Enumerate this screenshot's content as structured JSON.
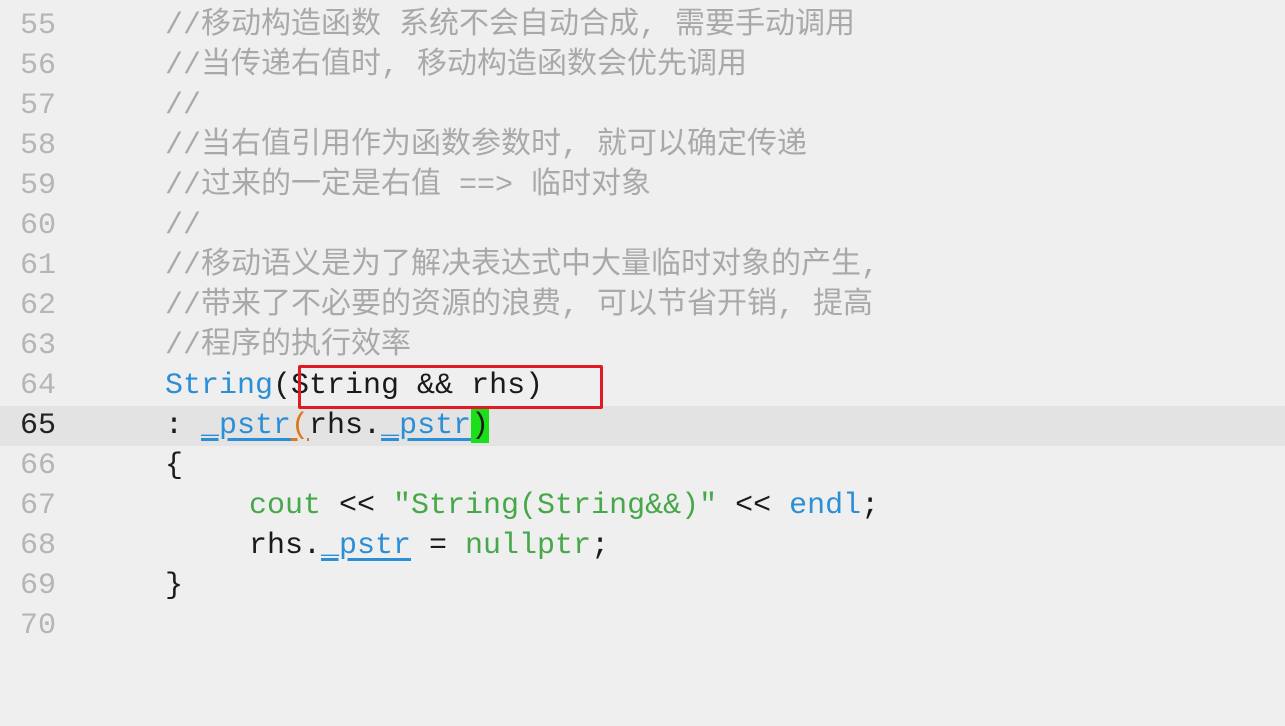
{
  "editor": {
    "colors": {
      "background": "#efefef",
      "current_line": "#e3e3e3",
      "comment": "#a9a9a9",
      "type": "#2c8fd6",
      "builtin": "#47a84a",
      "bracket_match": "#19e019",
      "highlight_box": "#e01b24"
    },
    "line_numbers": [
      "55",
      "56",
      "57",
      "58",
      "59",
      "60",
      "61",
      "62",
      "63",
      "64",
      "65",
      "66",
      "67",
      "68",
      "69",
      "70"
    ],
    "comments": {
      "l55": "//移动构造函数 系统不会自动合成, 需要手动调用",
      "l56": "//当传递右值时, 移动构造函数会优先调用",
      "l57": "//",
      "l58": "//当右值引用作为函数参数时, 就可以确定传递",
      "l59": "//过来的一定是右值 ==> 临时对象",
      "l60": "//",
      "l61": "//移动语义是为了解决表达式中大量临时对象的产生,",
      "l62": "//带来了不必要的资源的浪费, 可以节省开销, 提高",
      "l63": "//程序的执行效率"
    },
    "l64": {
      "name": "String",
      "params": "(String && rhs)"
    },
    "l65": {
      "colon": ": ",
      "member": "_pstr",
      "open_paren": "(",
      "arg_prefix": "rhs.",
      "arg_member": "_pstr",
      "close_paren": ")"
    },
    "l66": {
      "brace": "{"
    },
    "l67": {
      "cout": "cout",
      "op1": " << ",
      "literal": "\"String(String&&)\"",
      "op2": " << ",
      "endl": "endl",
      "semi": ";"
    },
    "l68": {
      "lhs_prefix": "rhs.",
      "lhs_member": "_pstr",
      "assign": " = ",
      "value": "nullptr",
      "semi": ";"
    },
    "l69": {
      "brace": "}"
    }
  }
}
